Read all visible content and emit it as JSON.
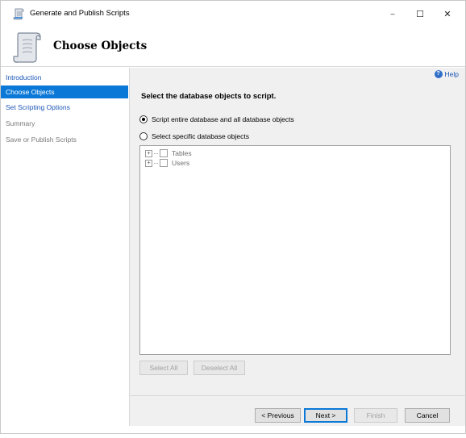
{
  "window": {
    "title": "Generate and Publish Scripts",
    "icon": "scroll-icon",
    "controls": {
      "minimize": "–",
      "maximize": "☐",
      "close": "✕"
    }
  },
  "banner": {
    "title": "Choose Objects",
    "icon": "scroll-icon"
  },
  "sidebar": {
    "items": [
      {
        "label": "Introduction",
        "state": "link"
      },
      {
        "label": "Choose Objects",
        "state": "selected"
      },
      {
        "label": "Set Scripting Options",
        "state": "link"
      },
      {
        "label": "Summary",
        "state": "disabled"
      },
      {
        "label": "Save or Publish Scripts",
        "state": "disabled"
      }
    ]
  },
  "main": {
    "help_label": "Help",
    "heading": "Select the database objects to script.",
    "options": [
      {
        "label": "Script entire database and all database objects",
        "checked": true
      },
      {
        "label": "Select specific database objects",
        "checked": false
      }
    ],
    "tree": [
      {
        "label": "Tables",
        "expander": "+",
        "checked": false
      },
      {
        "label": "Users",
        "expander": "+",
        "checked": false
      }
    ],
    "select_all_label": "Select All",
    "deselect_all_label": "Deselect All"
  },
  "footer": {
    "previous_label": "< Previous",
    "next_label": "Next >",
    "finish_label": "Finish",
    "cancel_label": "Cancel"
  },
  "colors": {
    "accent": "#0a78d7",
    "link": "#1a55b5",
    "panel": "#f0f0f0"
  }
}
